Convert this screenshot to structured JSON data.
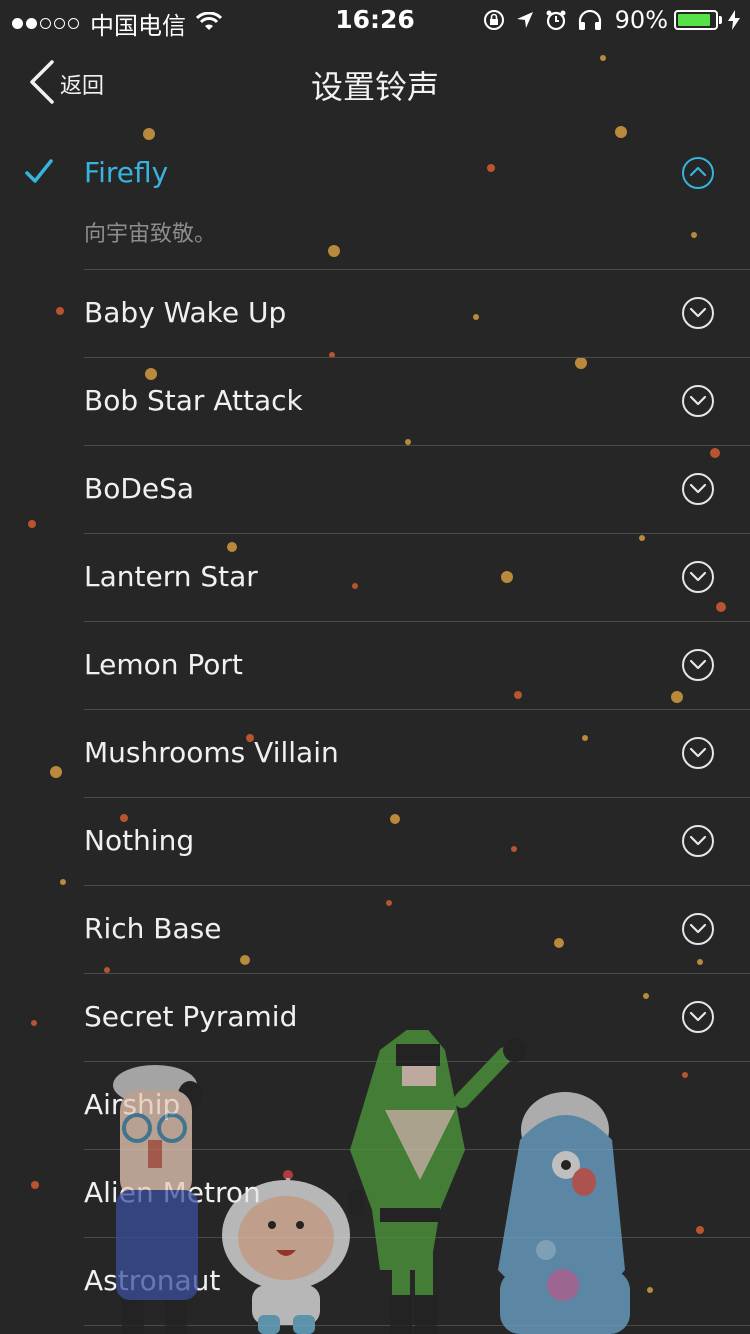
{
  "status_bar": {
    "carrier": "中国电信",
    "time": "16:26",
    "battery_percent": "90%",
    "battery_level": 0.9,
    "signal_bars": 2,
    "signal_total": 5
  },
  "nav": {
    "back_label": "返回",
    "title": "设置铃声"
  },
  "colors": {
    "accent": "#37b4de",
    "background": "#262626",
    "battery_green": "#55e14a"
  },
  "ringtones": [
    {
      "name": "Firefly",
      "selected": true,
      "expanded": true,
      "description": "向宇宙致敬。"
    },
    {
      "name": "Baby Wake Up"
    },
    {
      "name": "Bob Star Attack"
    },
    {
      "name": "BoDeSa"
    },
    {
      "name": "Lantern Star"
    },
    {
      "name": "Lemon Port"
    },
    {
      "name": "Mushrooms Villain"
    },
    {
      "name": "Nothing"
    },
    {
      "name": "Rich Base"
    },
    {
      "name": "Secret Pyramid"
    },
    {
      "name": "Airship"
    },
    {
      "name": "Alien Metron"
    },
    {
      "name": "Astronaut"
    }
  ]
}
